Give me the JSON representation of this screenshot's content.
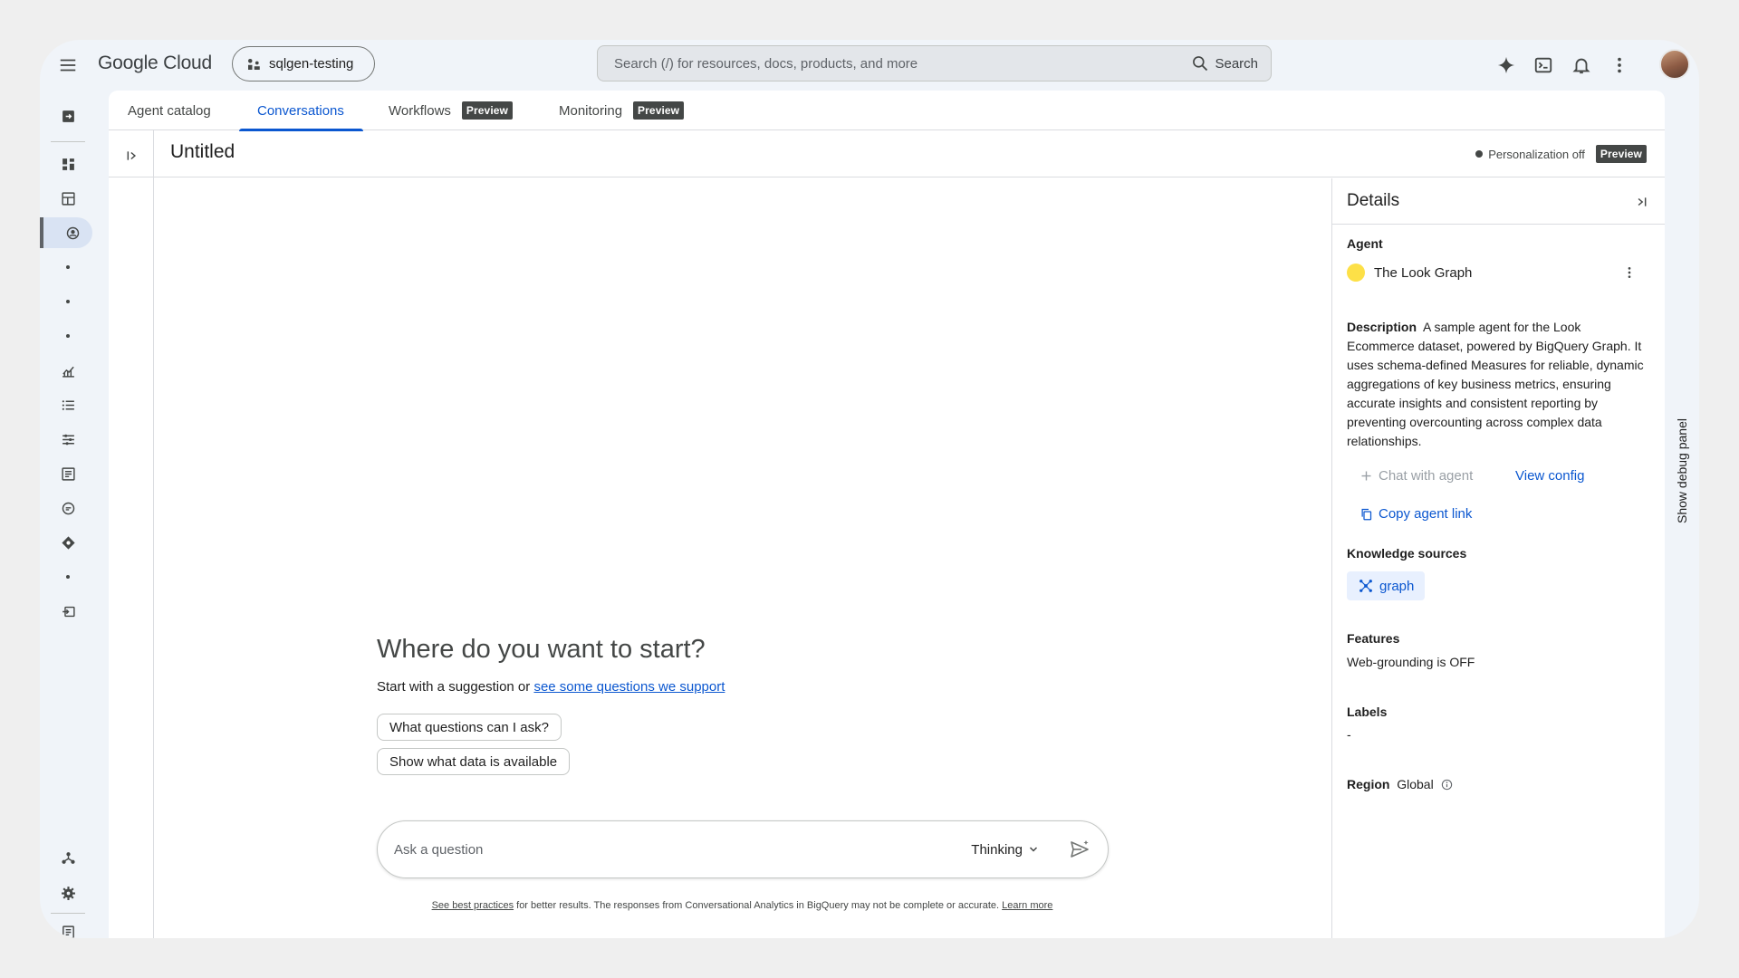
{
  "app": {
    "logo": "Google Cloud"
  },
  "project": {
    "name": "sqlgen-testing"
  },
  "search": {
    "placeholder": "Search (/) for resources, docs, products, and more",
    "button_label": "Search"
  },
  "tabs": [
    {
      "label": "Agent catalog"
    },
    {
      "label": "Conversations",
      "active": true
    },
    {
      "label": "Workflows",
      "badge": "Preview"
    },
    {
      "label": "Monitoring",
      "badge": "Preview"
    }
  ],
  "page": {
    "title": "Untitled",
    "personalization_label": "Personalization off",
    "personalization_badge": "Preview"
  },
  "chat": {
    "heading": "Where do you want to start?",
    "sub_prefix": "Start with a suggestion or",
    "sub_link": "see some questions we support",
    "suggestions": [
      "What questions can I ask?",
      "Show what data is available"
    ],
    "input_placeholder": "Ask a question",
    "mode": "Thinking",
    "disclaimer_link1": "See best practices",
    "disclaimer_text": " for better results. The responses from Conversational Analytics in BigQuery may not be complete or accurate. ",
    "disclaimer_link2": "Learn more"
  },
  "details": {
    "title": "Details",
    "agent_label": "Agent",
    "agent_name": "The Look Graph",
    "description_label": "Description",
    "description_text": "A sample agent for the Look Ecommerce dataset, powered by BigQuery Graph. It uses schema-defined Measures for reliable, dynamic aggregations of key business metrics, ensuring accurate insights and consistent reporting by preventing overcounting across complex data relationships.",
    "chat_with_agent": "Chat with agent",
    "view_config": "View config",
    "copy_agent_link": "Copy agent link",
    "knowledge_label": "Knowledge sources",
    "knowledge_chip": "graph",
    "features_label": "Features",
    "features_value": "Web-grounding is OFF",
    "labels_label": "Labels",
    "labels_value": "-",
    "region_label": "Region",
    "region_value": "Global"
  },
  "debug_panel": {
    "label": "Show debug panel"
  },
  "colors": {
    "accent": "#0b57d0",
    "agent_dot": "#fde047",
    "badge_bg": "#444746"
  }
}
